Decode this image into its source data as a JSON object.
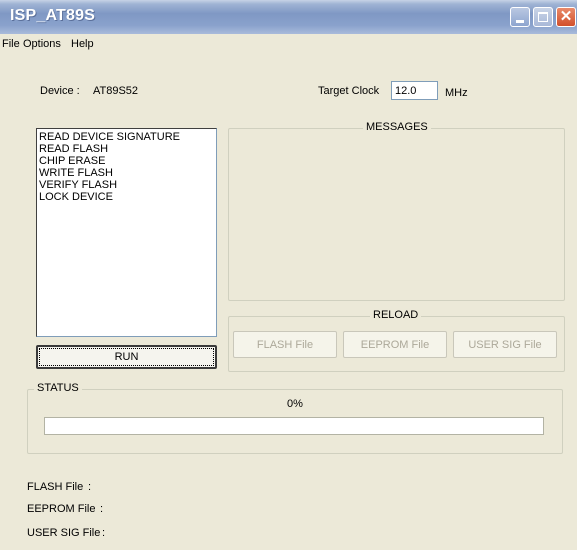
{
  "window": {
    "title": "ISP_AT89S"
  },
  "menu": {
    "items": [
      "File",
      "Options",
      "Help"
    ]
  },
  "device": {
    "label": "Device :",
    "value": "AT89S52"
  },
  "target_clock": {
    "label": "Target Clock",
    "value": "12.0",
    "unit": "MHz"
  },
  "operations": [
    "READ DEVICE SIGNATURE",
    "READ FLASH",
    "CHIP ERASE",
    "WRITE FLASH",
    "VERIFY FLASH",
    "LOCK DEVICE"
  ],
  "run_button": "RUN",
  "messages": {
    "title": "MESSAGES"
  },
  "reload": {
    "title": "RELOAD",
    "buttons": [
      "FLASH File",
      "EEPROM File",
      "USER SIG  File"
    ]
  },
  "status": {
    "title": "STATUS",
    "progress_text": "0%",
    "progress_value": 0
  },
  "files": [
    {
      "label": "FLASH File",
      "sep": ":"
    },
    {
      "label": "EEPROM File",
      "sep": ":"
    },
    {
      "label": "USER SIG File",
      "sep": ":"
    }
  ],
  "colors": {
    "titlebar": "#8aa2cc",
    "window_bg": "#ece9d8",
    "close_button": "#d2502c"
  }
}
